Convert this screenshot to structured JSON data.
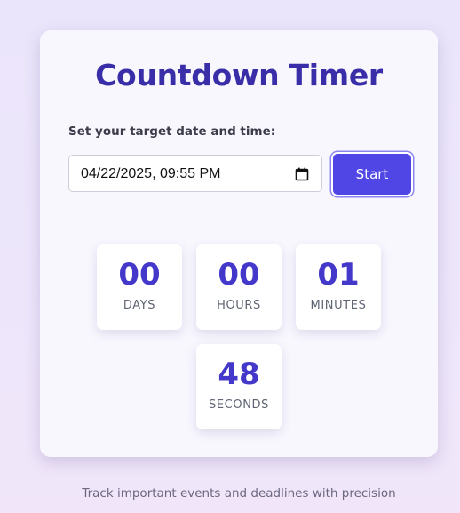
{
  "title": "Countdown Timer",
  "label": "Set your target date and time:",
  "date_input": {
    "value": "04/22/2025, 09:55 PM"
  },
  "start_button": {
    "label": "Start"
  },
  "countdown": {
    "days": {
      "value": "00",
      "label": "DAYS"
    },
    "hours": {
      "value": "00",
      "label": "HOURS"
    },
    "minutes": {
      "value": "01",
      "label": "MINUTES"
    },
    "seconds": {
      "value": "48",
      "label": "SECONDS"
    }
  },
  "footer": "Track important events and deadlines with precision",
  "colors": {
    "accent": "#4f46e5",
    "title": "#3a2ea8",
    "digits": "#4338ca"
  },
  "icons": {
    "date_picker": "calendar-icon"
  }
}
